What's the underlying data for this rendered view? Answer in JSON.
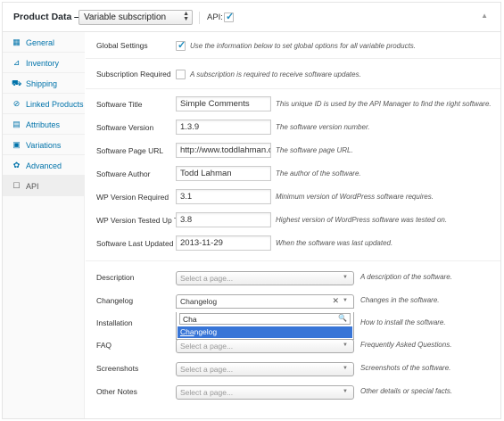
{
  "header": {
    "title": "Product Data —",
    "product_type": "Variable subscription",
    "api_label": "API:",
    "api_checked": true,
    "collapse_icon": "triangle-up-icon"
  },
  "tabs": [
    {
      "label": "General",
      "icon": "grid-icon"
    },
    {
      "label": "Inventory",
      "icon": "chart-icon"
    },
    {
      "label": "Shipping",
      "icon": "truck-icon"
    },
    {
      "label": "Linked Products",
      "icon": "link-icon"
    },
    {
      "label": "Attributes",
      "icon": "list-icon"
    },
    {
      "label": "Variations",
      "icon": "calendar-icon"
    },
    {
      "label": "Advanced",
      "icon": "gear-icon"
    },
    {
      "label": "API",
      "icon": "document-icon"
    }
  ],
  "options": {
    "global_settings": {
      "label": "Global Settings",
      "checked": true,
      "description": "Use the information below to set global options for all variable products."
    },
    "subscription_required": {
      "label": "Subscription Required",
      "checked": false,
      "description": "A subscription is required to receive software updates."
    }
  },
  "fields": [
    {
      "label": "Software Title",
      "value": "Simple Comments",
      "description": "This unique ID is used by the API Manager to find the right software."
    },
    {
      "label": "Software Version",
      "value": "1.3.9",
      "description": "The software version number."
    },
    {
      "label": "Software Page URL",
      "value": "http://www.toddlahman.co",
      "description": "The software page URL."
    },
    {
      "label": "Software Author",
      "value": "Todd Lahman",
      "description": "The author of the software."
    },
    {
      "label": "WP Version Required",
      "value": "3.1",
      "description": "Minimum version of WordPress software requires."
    },
    {
      "label": "WP Version Tested Up To",
      "value": "3.8",
      "description": "Highest version of WordPress software was tested on."
    },
    {
      "label": "Software Last Updated",
      "value": "2013-11-29",
      "description": "When the software was last updated."
    }
  ],
  "pages": [
    {
      "label": "Description",
      "value": "Select a page...",
      "description": "A description of the software."
    },
    {
      "label": "Changelog",
      "value": "Changelog",
      "description": "Changes in the software."
    },
    {
      "label": "Installation",
      "value": "",
      "description": "How to install the software."
    },
    {
      "label": "FAQ",
      "value": "Select a page...",
      "description": "Frequently Asked Questions."
    },
    {
      "label": "Screenshots",
      "value": "Select a page...",
      "description": "Screenshots of the software."
    },
    {
      "label": "Other Notes",
      "value": "Select a page...",
      "description": "Other details or special facts."
    }
  ],
  "dropdown": {
    "search_value": "Cha",
    "option_match": "Cha",
    "option_rest": "ngelog"
  }
}
